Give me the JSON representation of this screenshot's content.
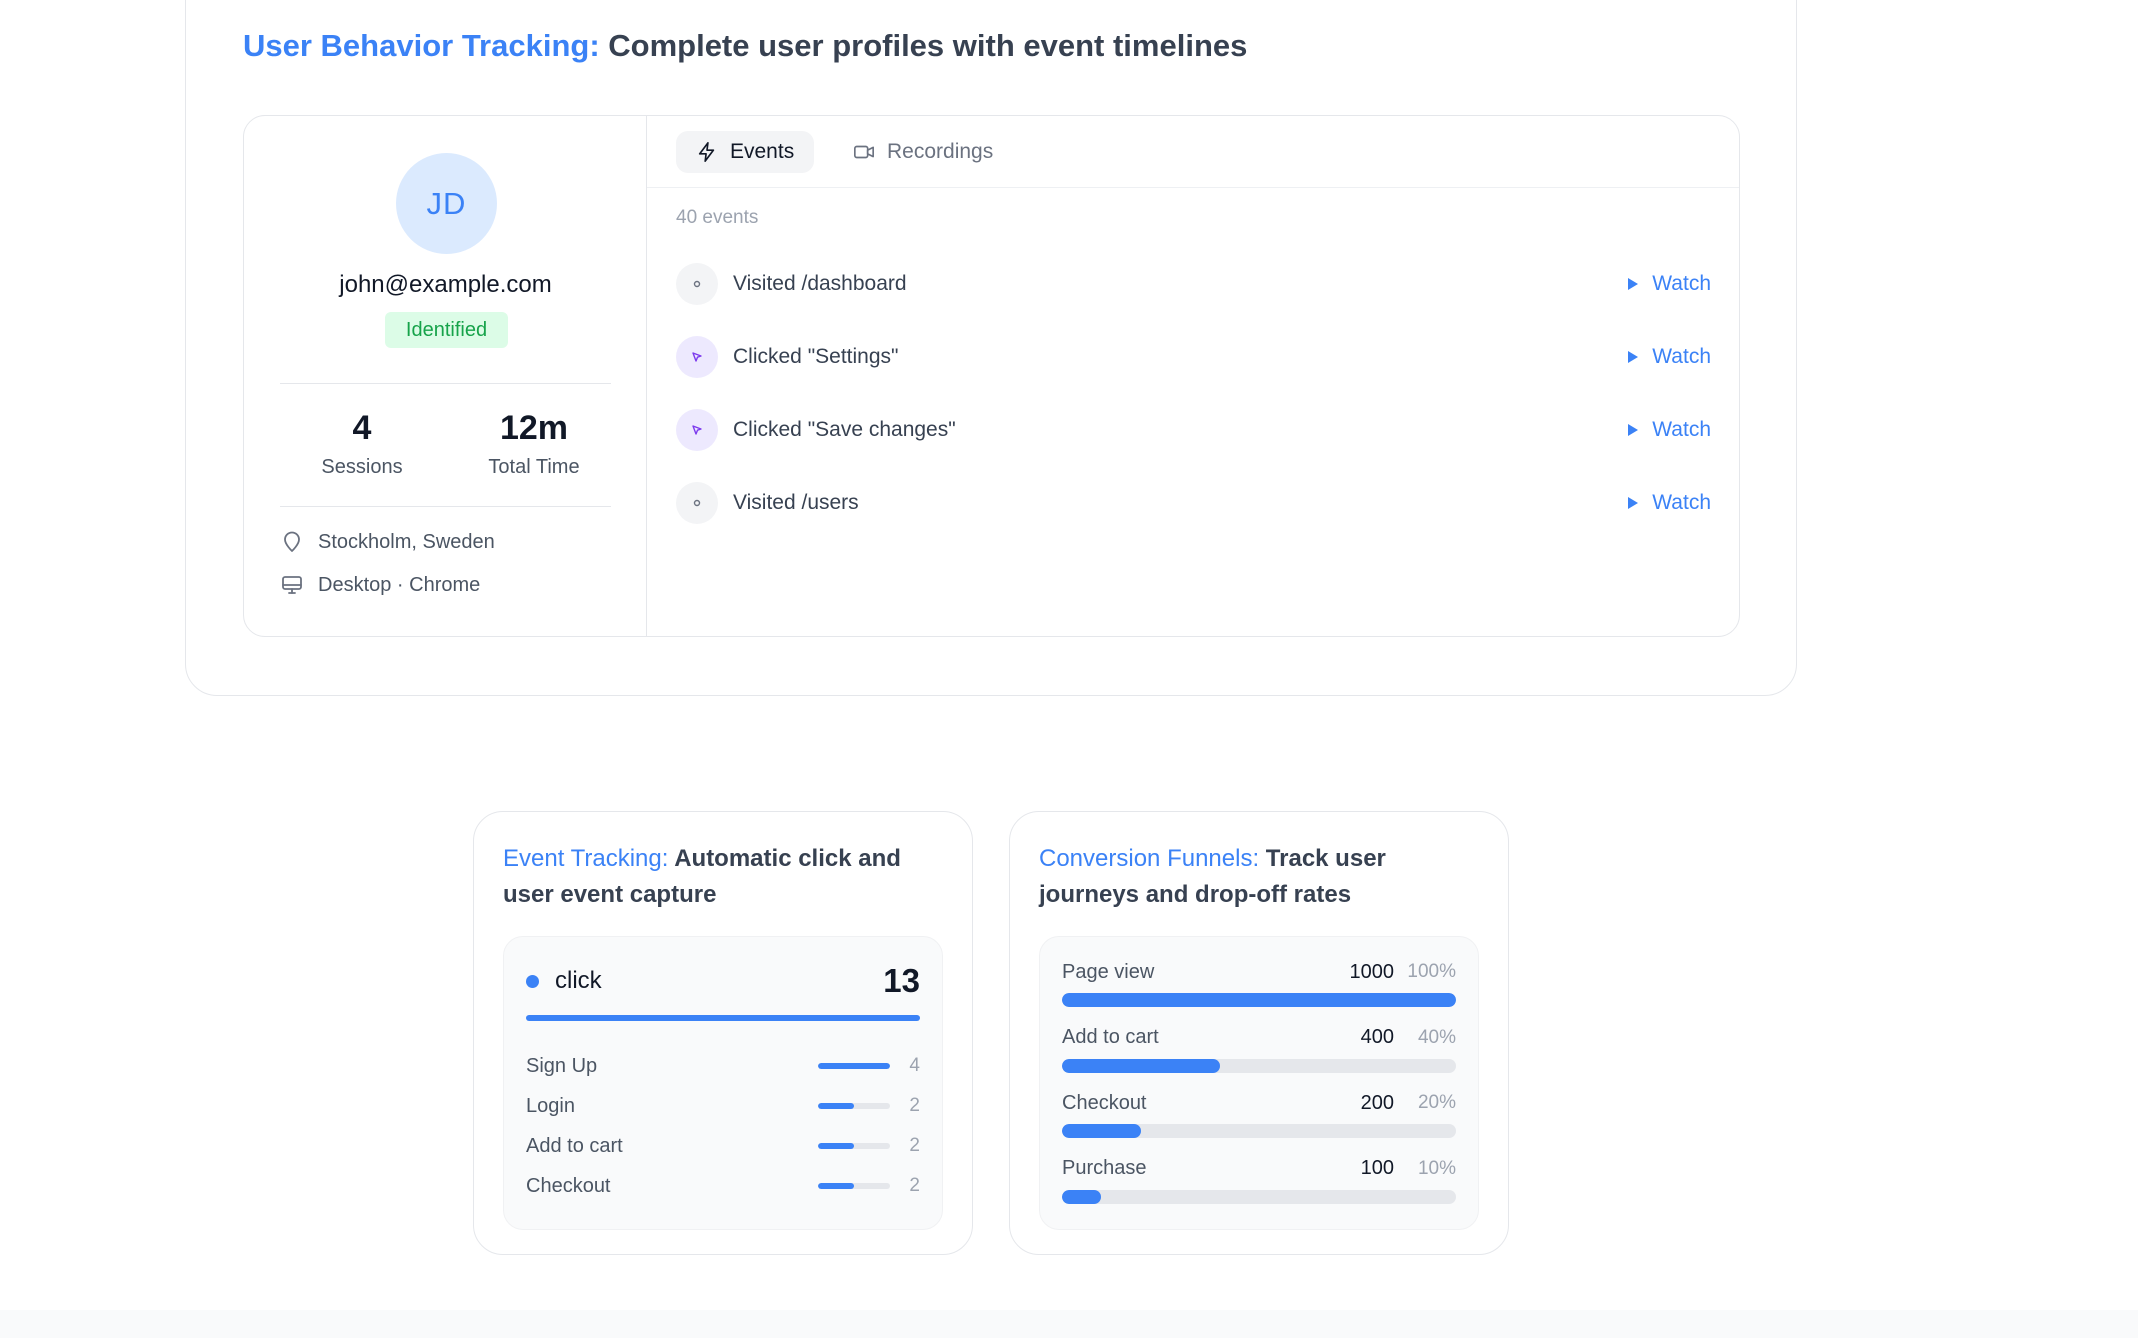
{
  "main_feature": {
    "accent": "User Behavior Tracking:",
    "rest": " Complete user profiles with event timelines"
  },
  "profile": {
    "initials": "JD",
    "email": "john@example.com",
    "status": "Identified",
    "stats": [
      {
        "value": "4",
        "label": "Sessions"
      },
      {
        "value": "12m",
        "label": "Total Time"
      }
    ],
    "location": "Stockholm, Sweden",
    "device": "Desktop · Chrome"
  },
  "tabs": [
    {
      "label": "Events",
      "icon": "lightning-icon",
      "active": true
    },
    {
      "label": "Recordings",
      "icon": "video-icon",
      "active": false
    }
  ],
  "events": {
    "count_label": "40 events",
    "watch_label": "Watch",
    "items": [
      {
        "type": "page",
        "label": "Visited /dashboard"
      },
      {
        "type": "click",
        "label": "Clicked \"Settings\""
      },
      {
        "type": "click",
        "label": "Clicked \"Save changes\""
      },
      {
        "type": "page",
        "label": "Visited /users"
      }
    ]
  },
  "event_tracking": {
    "accent": "Event Tracking:",
    "rest": " Automatic click and user event capture",
    "primary": {
      "name": "click",
      "count": "13"
    },
    "items": [
      {
        "label": "Sign Up",
        "value": 4,
        "fraction": 1.0
      },
      {
        "label": "Login",
        "value": 2,
        "fraction": 0.5
      },
      {
        "label": "Add to cart",
        "value": 2,
        "fraction": 0.5
      },
      {
        "label": "Checkout",
        "value": 2,
        "fraction": 0.5
      }
    ]
  },
  "funnels": {
    "accent": "Conversion Funnels:",
    "rest": " Track user journeys and drop-off rates",
    "steps": [
      {
        "label": "Page view",
        "count": "1000",
        "percent": "100%",
        "fraction": 1.0
      },
      {
        "label": "Add to cart",
        "count": "400",
        "percent": "40%",
        "fraction": 0.4
      },
      {
        "label": "Checkout",
        "count": "200",
        "percent": "20%",
        "fraction": 0.2
      },
      {
        "label": "Purchase",
        "count": "100",
        "percent": "10%",
        "fraction": 0.1
      }
    ]
  },
  "colors": {
    "accent": "#3b82f6",
    "identified_bg": "#dcfce7",
    "identified_text": "#16a34a",
    "click_icon_bg": "#ede9fe"
  }
}
